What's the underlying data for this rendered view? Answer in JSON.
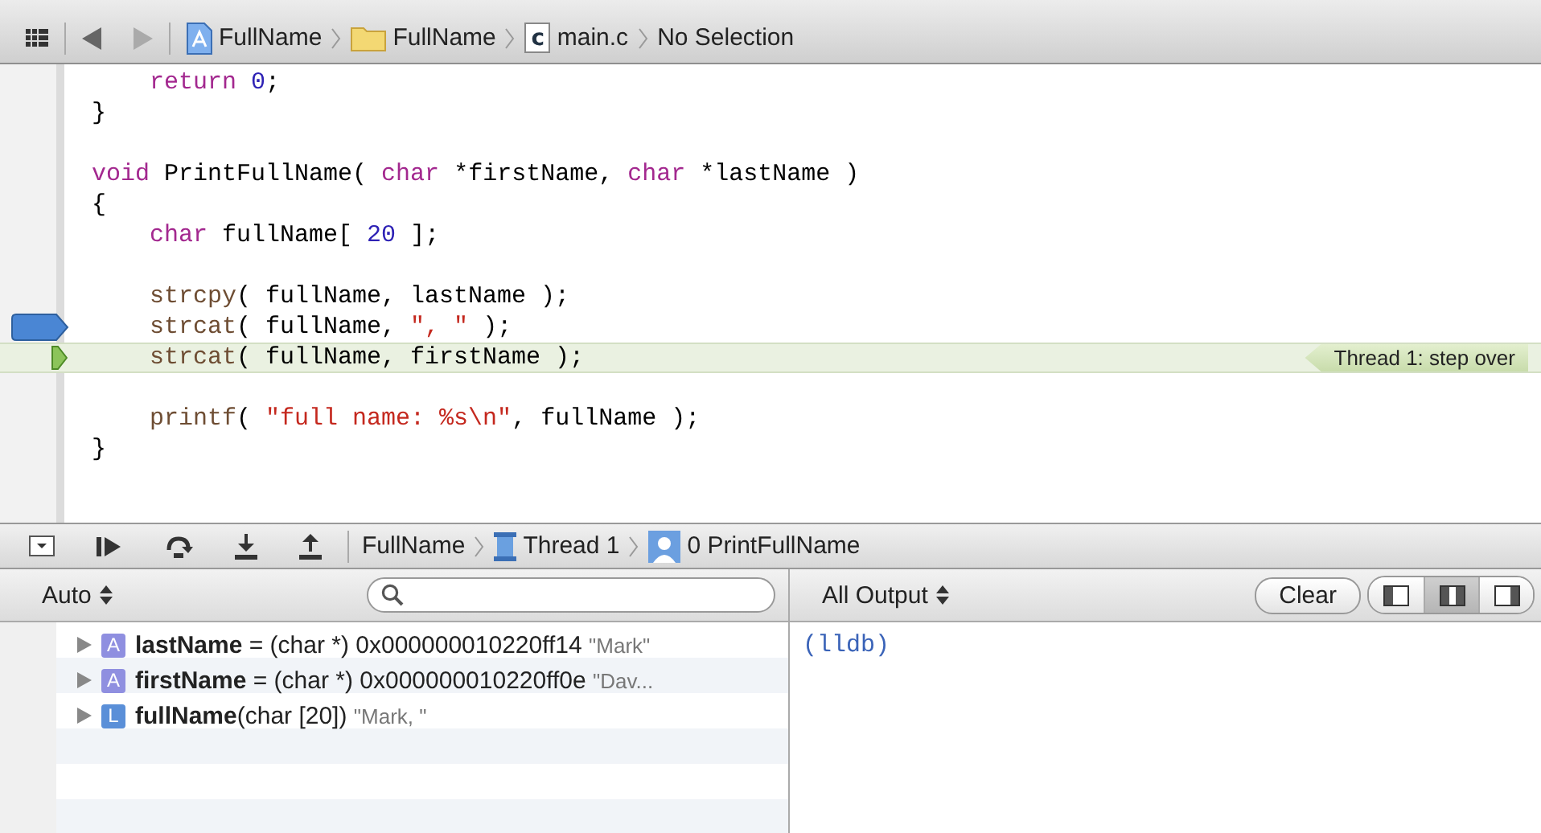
{
  "jump_bar": {
    "crumbs": [
      {
        "kind": "project",
        "label": "FullName"
      },
      {
        "kind": "folder",
        "label": "FullName"
      },
      {
        "kind": "file",
        "icon_letter": "c",
        "label": "main.c"
      },
      {
        "kind": "plain",
        "label": "No Selection"
      }
    ]
  },
  "editor": {
    "lines": [
      {
        "kind": "code",
        "breakpoint": false,
        "current": false,
        "tokens": [
          {
            "kind": "kw",
            "text": "    return"
          },
          {
            "kind": "num",
            "text": " 0"
          },
          {
            "kind": "plain",
            "text": ";"
          }
        ]
      },
      {
        "kind": "code",
        "breakpoint": false,
        "current": false,
        "tokens": [
          {
            "kind": "plain",
            "text": "}"
          }
        ]
      },
      {
        "kind": "blank"
      },
      {
        "kind": "code",
        "breakpoint": false,
        "current": false,
        "tokens": [
          {
            "kind": "kw",
            "text": "void"
          },
          {
            "kind": "plain",
            "text": " PrintFullName( "
          },
          {
            "kind": "kw",
            "text": "char"
          },
          {
            "kind": "plain",
            "text": " *firstName, "
          },
          {
            "kind": "kw",
            "text": "char"
          },
          {
            "kind": "plain",
            "text": " *lastName )"
          }
        ]
      },
      {
        "kind": "code",
        "breakpoint": false,
        "current": false,
        "tokens": [
          {
            "kind": "plain",
            "text": "{"
          }
        ]
      },
      {
        "kind": "code",
        "breakpoint": false,
        "current": false,
        "tokens": [
          {
            "kind": "kw",
            "text": "    char"
          },
          {
            "kind": "plain",
            "text": " fullName[ "
          },
          {
            "kind": "num",
            "text": "20"
          },
          {
            "kind": "plain",
            "text": " ];"
          }
        ]
      },
      {
        "kind": "blank"
      },
      {
        "kind": "code",
        "breakpoint": false,
        "current": false,
        "tokens": [
          {
            "kind": "fn",
            "text": "    strcpy"
          },
          {
            "kind": "plain",
            "text": "( fullName, lastName );"
          }
        ]
      },
      {
        "kind": "code",
        "breakpoint": true,
        "current": false,
        "tokens": [
          {
            "kind": "fn",
            "text": "    strcat"
          },
          {
            "kind": "plain",
            "text": "( fullName, "
          },
          {
            "kind": "str",
            "text": "\", \""
          },
          {
            "kind": "plain",
            "text": " );"
          }
        ]
      },
      {
        "kind": "code",
        "breakpoint": false,
        "current": true,
        "thread_label": "Thread 1: step over",
        "tokens": [
          {
            "kind": "fn",
            "text": "    strcat"
          },
          {
            "kind": "plain",
            "text": "( fullName, firstName );"
          }
        ]
      },
      {
        "kind": "blank"
      },
      {
        "kind": "code",
        "breakpoint": false,
        "current": false,
        "tokens": [
          {
            "kind": "fn",
            "text": "    printf"
          },
          {
            "kind": "plain",
            "text": "( "
          },
          {
            "kind": "str",
            "text": "\"full name: %s\\n\""
          },
          {
            "kind": "plain",
            "text": ", fullName );"
          }
        ]
      },
      {
        "kind": "code",
        "breakpoint": false,
        "current": false,
        "tokens": [
          {
            "kind": "plain",
            "text": "}"
          }
        ]
      }
    ]
  },
  "debug_bar": {
    "crumbs": [
      {
        "kind": "plain",
        "label": "FullName"
      },
      {
        "kind": "thread",
        "label": "Thread 1"
      },
      {
        "kind": "frame",
        "label": "0 PrintFullName"
      }
    ]
  },
  "variables": {
    "scope": "Auto",
    "items": [
      {
        "kind": "argument",
        "badge": "A",
        "name": "lastName",
        "detail": " = (char *) 0x000000010220ff14 ",
        "summary": "\"Mark\"",
        "expanded": false
      },
      {
        "kind": "argument",
        "badge": "A",
        "name": "firstName",
        "detail": " = (char *) 0x000000010220ff0e ",
        "summary": "\"Dav...",
        "expanded": false
      },
      {
        "kind": "local",
        "badge": "L",
        "name": "fullName",
        "detail": "(char [20])  ",
        "summary": "\"Mark, \"",
        "expanded": false
      }
    ]
  },
  "console": {
    "filter": "All Output",
    "clear_button": "Clear",
    "views": [
      {
        "kind": "left",
        "selected": false
      },
      {
        "kind": "both",
        "selected": true
      },
      {
        "kind": "right",
        "selected": false
      }
    ],
    "output": "(lldb)"
  }
}
